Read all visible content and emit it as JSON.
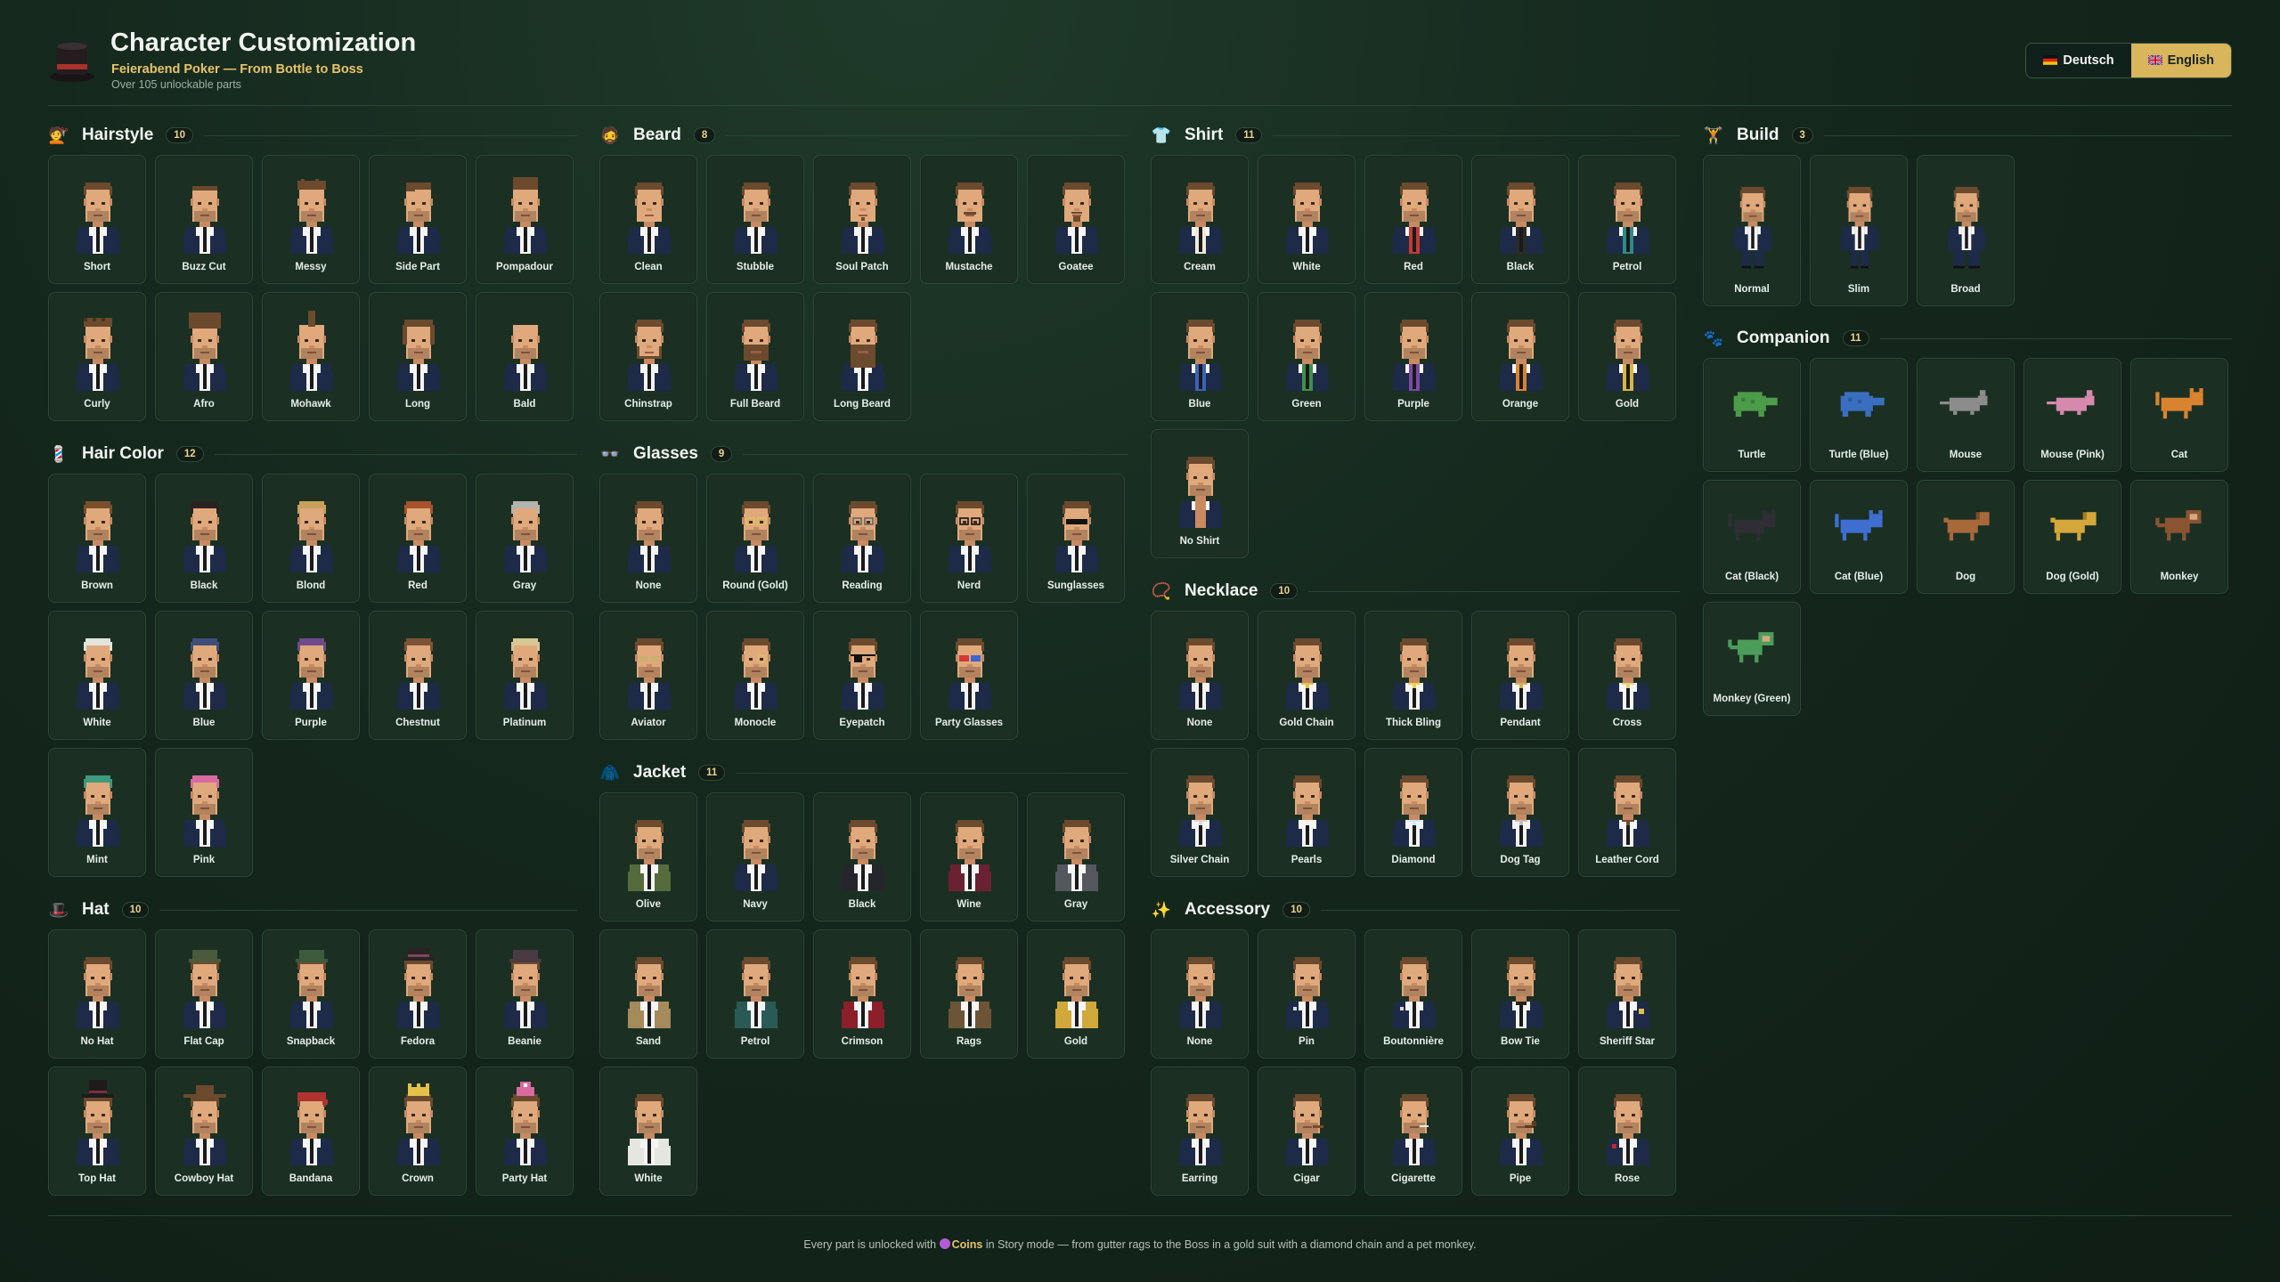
{
  "header": {
    "title": "Character Customization",
    "subtitle": "Feierabend Poker — From Bottle to Boss",
    "info": "Over 105 unlockable parts",
    "icon": "top-hat-icon"
  },
  "languages": [
    {
      "label": "Deutsch",
      "flag": "de",
      "active": false
    },
    {
      "label": "English",
      "flag": "gb",
      "active": true
    }
  ],
  "colors": {
    "accent": "#d9b55c",
    "background": "#15281d",
    "card": "#1b3023"
  },
  "sections": {
    "hairstyle": {
      "title": "Hairstyle",
      "count": "10",
      "icon": "hairstyle-icon",
      "items": [
        "Short",
        "Buzz Cut",
        "Messy",
        "Side Part",
        "Pompadour",
        "Curly",
        "Afro",
        "Mohawk",
        "Long",
        "Bald"
      ]
    },
    "hair_color": {
      "title": "Hair Color",
      "count": "12",
      "icon": "barber-pole-icon",
      "items": [
        "Brown",
        "Black",
        "Blond",
        "Red",
        "Gray",
        "White",
        "Blue",
        "Purple",
        "Chestnut",
        "Platinum",
        "Mint",
        "Pink"
      ]
    },
    "hat": {
      "title": "Hat",
      "count": "10",
      "icon": "top-hat-icon",
      "items": [
        "No Hat",
        "Flat Cap",
        "Snapback",
        "Fedora",
        "Beanie",
        "Top Hat",
        "Cowboy Hat",
        "Bandana",
        "Crown",
        "Party Hat"
      ]
    },
    "beard": {
      "title": "Beard",
      "count": "8",
      "icon": "bearded-face-icon",
      "items": [
        "Clean",
        "Stubble",
        "Soul Patch",
        "Mustache",
        "Goatee",
        "Chinstrap",
        "Full Beard",
        "Long Beard"
      ]
    },
    "glasses": {
      "title": "Glasses",
      "count": "9",
      "icon": "glasses-icon",
      "items": [
        "None",
        "Round (Gold)",
        "Reading",
        "Nerd",
        "Sunglasses",
        "Aviator",
        "Monocle",
        "Eyepatch",
        "Party Glasses"
      ]
    },
    "jacket": {
      "title": "Jacket",
      "count": "11",
      "icon": "coat-icon",
      "items": [
        "Olive",
        "Navy",
        "Black",
        "Wine",
        "Gray",
        "Sand",
        "Petrol",
        "Crimson",
        "Rags",
        "Gold",
        "White"
      ]
    },
    "shirt": {
      "title": "Shirt",
      "count": "11",
      "icon": "shirt-icon",
      "items": [
        "Cream",
        "White",
        "Red",
        "Black",
        "Petrol",
        "Blue",
        "Green",
        "Purple",
        "Orange",
        "Gold",
        "No Shirt"
      ]
    },
    "necklace": {
      "title": "Necklace",
      "count": "10",
      "icon": "necklace-icon",
      "items": [
        "None",
        "Gold Chain",
        "Thick Bling",
        "Pendant",
        "Cross",
        "Silver Chain",
        "Pearls",
        "Diamond",
        "Dog Tag",
        "Leather Cord"
      ]
    },
    "accessory": {
      "title": "Accessory",
      "count": "10",
      "icon": "sparkles-icon",
      "items": [
        "None",
        "Pin",
        "Boutonnière",
        "Bow Tie",
        "Sheriff Star",
        "Earring",
        "Cigar",
        "Cigarette",
        "Pipe",
        "Rose"
      ]
    },
    "build": {
      "title": "Build",
      "count": "3",
      "icon": "weightlifter-icon",
      "items": [
        "Normal",
        "Slim",
        "Broad"
      ]
    },
    "companion": {
      "title": "Companion",
      "count": "11",
      "icon": "paw-prints-icon",
      "items": [
        "Turtle",
        "Turtle (Blue)",
        "Mouse",
        "Mouse (Pink)",
        "Cat",
        "Cat (Black)",
        "Cat (Blue)",
        "Dog",
        "Dog (Gold)",
        "Monkey",
        "Monkey (Green)"
      ]
    }
  },
  "variants": {
    "hairstyle": [
      {
        "hair": "#6b4a2e",
        "style": "short"
      },
      {
        "hair": "#6b4a2e",
        "style": "buzz"
      },
      {
        "hair": "#6b4a2e",
        "style": "messy"
      },
      {
        "hair": "#6b4a2e",
        "style": "side"
      },
      {
        "hair": "#6b4a2e",
        "style": "pomp"
      },
      {
        "hair": "#6b4a2e",
        "style": "curly"
      },
      {
        "hair": "#6b4a2e",
        "style": "afro"
      },
      {
        "hair": "#6b4a2e",
        "style": "mohawk"
      },
      {
        "hair": "#6b4a2e",
        "style": "long"
      },
      {
        "hair": "#6b4a2e",
        "style": "bald"
      }
    ],
    "hair_color": [
      "#7a4f2c",
      "#2a2220",
      "#c9a05a",
      "#a8522b",
      "#b3b3ad",
      "#e4e4dc",
      "#3e4e7a",
      "#6e4a8a",
      "#7d5335",
      "#d7c792",
      "#3e9a7c",
      "#d96aa0"
    ],
    "hat": [
      "none",
      "#4a5a3a",
      "#3d5a3d",
      "#2a2226",
      "#4a3a44",
      "#1f1a1c",
      "#6b4a2e",
      "#b0332f",
      "#e6c04a",
      "#d96aa0"
    ],
    "beard": [
      "clean",
      "stubble",
      "soul",
      "mustache",
      "goatee",
      "chin",
      "full",
      "long"
    ],
    "glasses": [
      "none",
      "round",
      "reading",
      "nerd",
      "sun",
      "aviator",
      "monocle",
      "patch",
      "party"
    ],
    "jacket": [
      "#566b3c",
      "#1d2a48",
      "#25262b",
      "#6a2232",
      "#54585e",
      "#a58a5c",
      "#2a5a55",
      "#8c1f2a",
      "#6b5536",
      "#d0a93a",
      "#e6e6e0"
    ],
    "shirt": [
      "#f0ead8",
      "#ffffff",
      "#c23a32",
      "#2a2a2a",
      "#2f8a86",
      "#3b63b8",
      "#3f8f4a",
      "#7b4aa5",
      "#d98330",
      "#d9b540",
      "none"
    ],
    "necklace": [
      "none",
      "gold",
      "thick",
      "pendant",
      "cross",
      "silver",
      "pearls",
      "diamond",
      "dogtag",
      "leather"
    ],
    "accessory": [
      "none",
      "pin",
      "bout",
      "bowtie",
      "star",
      "earring",
      "cigar",
      "cig",
      "pipe",
      "rose"
    ],
    "build": [
      "normal",
      "slim",
      "broad"
    ],
    "companion": [
      {
        "kind": "turtle",
        "color": "#4c9c4a"
      },
      {
        "kind": "turtle",
        "color": "#3a6fc0"
      },
      {
        "kind": "mouse",
        "color": "#8c8c8c"
      },
      {
        "kind": "mouse",
        "color": "#d689ad"
      },
      {
        "kind": "cat",
        "color": "#d9832e"
      },
      {
        "kind": "cat",
        "color": "#2e2e34"
      },
      {
        "kind": "cat",
        "color": "#3e6fd0"
      },
      {
        "kind": "dog",
        "color": "#a8693a"
      },
      {
        "kind": "dog",
        "color": "#d4a73a"
      },
      {
        "kind": "monkey",
        "color": "#8a5432"
      },
      {
        "kind": "monkey",
        "color": "#4c9c5a"
      }
    ]
  },
  "footer": {
    "prefix": "Every part is unlocked with",
    "coins": "Coins",
    "suffix": "in Story mode — from gutter rags to the Boss in a gold suit with a diamond chain and a pet monkey."
  }
}
